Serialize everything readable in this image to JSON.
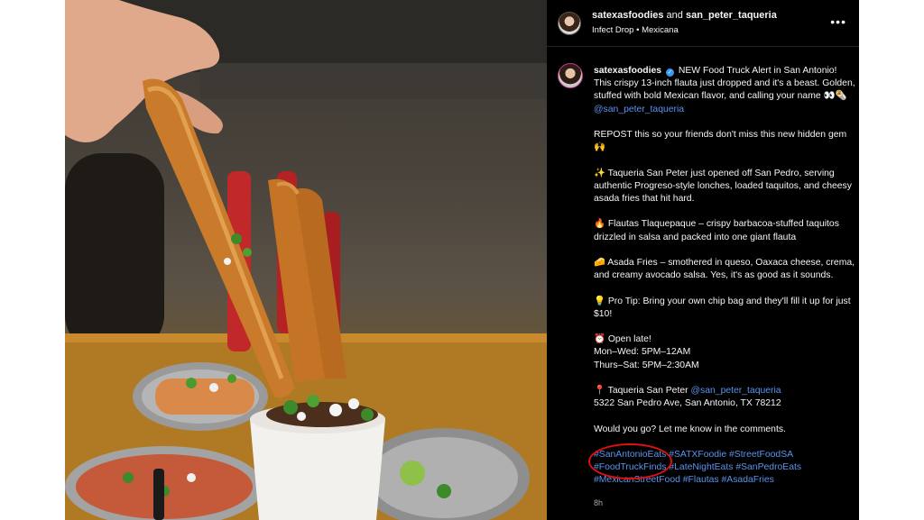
{
  "post": {
    "header": {
      "user1": "satexasfoodies",
      "and": "and",
      "user2": "san_peter_taqueria",
      "subtitle": "Infect Drop • Mexicana",
      "more": "•••"
    },
    "caption": {
      "username": "satexasfoodies",
      "verified": "✓",
      "intro": "NEW Food Truck Alert in San Antonio! This crispy 13-inch flauta just dropped and it's a beast. Golden, stuffed with bold Mexican flavor, and calling your name 👀🌯",
      "intro_mention": "@san_peter_taqueria",
      "repost": "REPOST this so your friends don't miss this new hidden gem 🙌",
      "p1": "✨ Taqueria San Peter just opened off San Pedro, serving authentic Progreso-style lonches, loaded taquitos, and cheesy asada fries that hit hard.",
      "p2": "🔥 Flautas Tlaquepaque – crispy barbacoa-stuffed taquitos drizzled in salsa and packed into one giant flauta",
      "p3": "🧀 Asada Fries – smothered in queso, Oaxaca cheese, crema, and creamy avocado salsa. Yes, it's as good as it sounds.",
      "p4": "💡 Pro Tip: Bring your own chip bag and they'll fill it up for just $10!",
      "hours_title": "⏰ Open late!",
      "hours_1": "Mon–Wed: 5PM–12AM",
      "hours_2": "Thurs–Sat: 5PM–2:30AM",
      "loc_label": "📍 Taqueria San Peter",
      "loc_mention": "@san_peter_taqueria",
      "address": "5322 San Pedro Ave, San Antonio, TX 78212",
      "cta": "Would you go? Let me know in the comments.",
      "hashtags": [
        "#SanAntonioEats",
        "#SATXFoodie",
        "#StreetFoodSA",
        "#FoodTruckFinds",
        "#LateNightEats",
        "#SanPedroEats",
        "#MexicanStreetFood",
        "#Flautas",
        "#AsadaFries"
      ]
    },
    "time": "8h"
  },
  "colors": {
    "panel_bg": "#000000",
    "link": "#5b94ee",
    "annotation": "#e01010",
    "verified": "#3897f0"
  }
}
